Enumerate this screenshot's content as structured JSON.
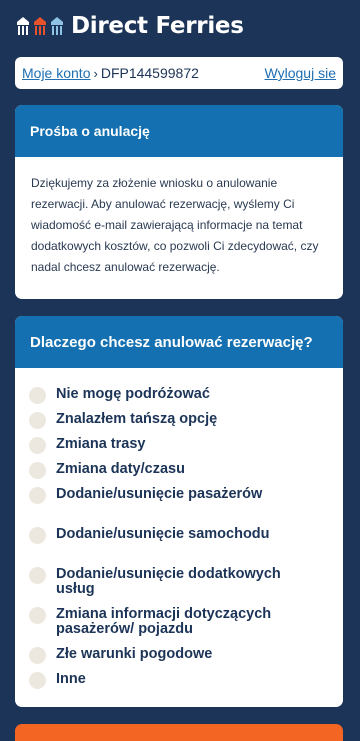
{
  "header": {
    "brand": "Direct Ferries",
    "colors": {
      "left_icon": "#ffffff",
      "middle_icon": "#e8522a",
      "right_icon": "#8ec3e6"
    }
  },
  "account": {
    "my_account_label": "Moje konto",
    "booking_ref": "DFP144599872",
    "logout_label": "Wyloguj sie"
  },
  "cancel_request": {
    "title": "Prośba o anulację",
    "body": "Dziękujemy za złożenie wniosku o anulowanie rezerwacji. Aby anulować rezerwację, wyślemy Ci wiadomość e-mail zawierającą informacje na temat dodatkowych kosztów, co pozwoli Ci zdecydować, czy nadal chcesz anulować rezerwację."
  },
  "reason": {
    "title": "Dlaczego chcesz anulować rezerwację?",
    "options": [
      "Nie mogę podróżować",
      "Znalazłem tańszą opcję",
      "Zmiana trasy",
      "Zmiana daty/czasu",
      "Dodanie/usunięcie pasażerów",
      "Dodanie/usunięcie samochodu",
      "Dodanie/usunięcie dodatkowych usług",
      "Zmiana informacji dotyczących pasażerów/ pojazdu",
      "Złe warunki pogodowe",
      "Inne"
    ]
  },
  "theme": {
    "page_bg": "#1c3457",
    "card_header": "#1470b0",
    "link": "#1f6fb2",
    "cta": "#f26522"
  }
}
